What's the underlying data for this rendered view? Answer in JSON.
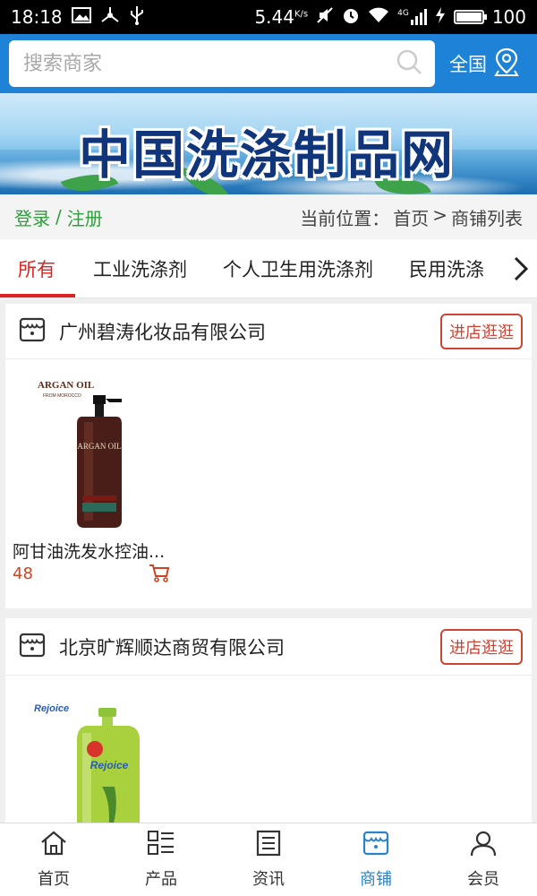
{
  "status_bar": {
    "time": "18:18",
    "speed": "5.44",
    "speed_unit": "K/s",
    "network": "4G",
    "battery": "100"
  },
  "search": {
    "placeholder": "搜索商家",
    "region_label": "全国"
  },
  "banner": {
    "title": "中国洗涤制品网"
  },
  "info_row": {
    "login_label": "登录",
    "separator": "/",
    "register_label": "注册",
    "location_prefix": "当前位置：",
    "crumb_home": "首页",
    "crumb_sep": ">",
    "crumb_current": "商铺列表"
  },
  "tabs": [
    {
      "label": "所有"
    },
    {
      "label": "工业洗涤剂"
    },
    {
      "label": "个人卫生用洗涤剂"
    },
    {
      "label": "民用洗涤"
    }
  ],
  "shops": [
    {
      "name": "广州碧涛化妆品有限公司",
      "visit_label": "进店逛逛",
      "products": [
        {
          "name": "阿甘油洗发水控油...",
          "price": "48",
          "brand_text": "ARGAN OIL"
        }
      ]
    },
    {
      "name": "北京旷辉顺达商贸有限公司",
      "visit_label": "进店逛逛",
      "products": [
        {
          "name": "",
          "price": "",
          "brand_text": "Rejoice"
        }
      ]
    }
  ],
  "bottom_nav": [
    {
      "label": "首页",
      "icon": "home-icon"
    },
    {
      "label": "产品",
      "icon": "product-list-icon"
    },
    {
      "label": "资讯",
      "icon": "news-icon"
    },
    {
      "label": "商铺",
      "icon": "shop-icon"
    },
    {
      "label": "会员",
      "icon": "member-icon"
    }
  ],
  "colors": {
    "header_blue": "#1e82d6",
    "active_red": "#dd2222",
    "login_green": "#2e9e3c",
    "nav_active": "#2a82c8"
  }
}
